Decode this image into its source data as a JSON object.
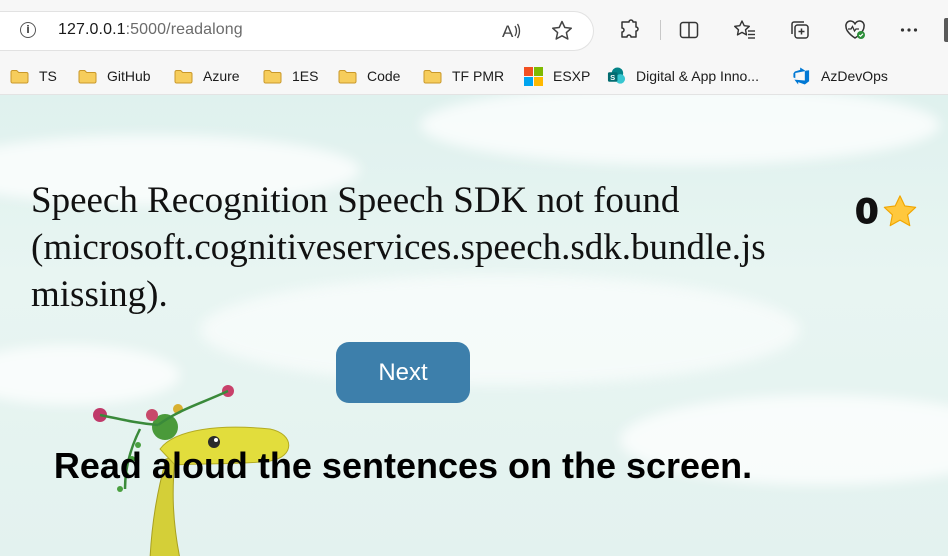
{
  "browser": {
    "url_host": "127.0.0.1",
    "url_path": ":5000/readalong",
    "bookmarks": [
      {
        "label": "TS",
        "icon": "folder-icon"
      },
      {
        "label": "GitHub",
        "icon": "folder-icon"
      },
      {
        "label": "Azure",
        "icon": "folder-icon"
      },
      {
        "label": "1ES",
        "icon": "folder-icon"
      },
      {
        "label": "Code",
        "icon": "folder-icon"
      },
      {
        "label": "TF PMR",
        "icon": "folder-icon"
      },
      {
        "label": "ESXP",
        "icon": "microsoft-logo-icon"
      },
      {
        "label": "Digital & App Inno...",
        "icon": "sharepoint-icon"
      },
      {
        "label": "AzDevOps",
        "icon": "azure-devops-icon"
      }
    ],
    "toolbar_icons": [
      "extensions-icon",
      "split-screen-icon",
      "favorites-icon",
      "collections-icon",
      "browser-health-icon",
      "more-icon"
    ]
  },
  "page": {
    "message": "Speech Recognition Speech SDK not found (microsoft.cognitiveservices.speech.sdk.bundle.js missing).",
    "score": "0",
    "next_label": "Next",
    "instruction": "Read aloud the sentences on the screen."
  },
  "colors": {
    "button": "#3d7fab",
    "star": "#ffc83d",
    "background": "#e3f2ef"
  }
}
